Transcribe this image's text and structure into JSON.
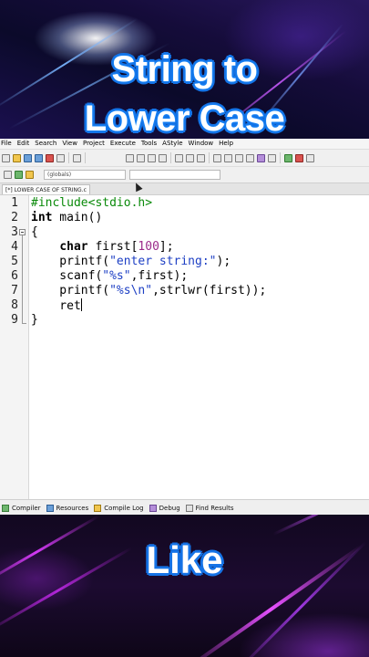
{
  "banner": {
    "title_line1": "String to",
    "title_line2": "Lower Case",
    "footer_text": "Like"
  },
  "menu": [
    "File",
    "Edit",
    "Search",
    "View",
    "Project",
    "Execute",
    "Tools",
    "AStyle",
    "Window",
    "Help"
  ],
  "class_combo": "(globals)",
  "file_tab": "[*] LOWER CASE OF STRING.c",
  "line_numbers": [
    "1",
    "2",
    "3",
    "4",
    "5",
    "6",
    "7",
    "8",
    "9"
  ],
  "code": {
    "l1_directive": "#include<stdio.h>",
    "l2_type": "int",
    "l2_rest": " main()",
    "l3": "{",
    "l4_indent": "    ",
    "l4_type": "char",
    "l4_rest1": " first[",
    "l4_num": "100",
    "l4_rest2": "];",
    "l5_fn": "    printf(",
    "l5_str": "\"enter string:\"",
    "l5_end": ");",
    "l6_fn": "    scanf(",
    "l6_str": "\"%s\"",
    "l6_end": ",first);",
    "l7_fn": "    printf(",
    "l7_str": "\"%s\\n\"",
    "l7_end": ",strlwr(first));",
    "l8_text": "    ret",
    "l9": "}"
  },
  "status_bar": [
    "Compiler",
    "Resources",
    "Compile Log",
    "Debug",
    "Find Results"
  ],
  "colors": {
    "title_outline": "#1573e6",
    "keyword_color": "#000000",
    "preprocessor_color": "#0a8a0a",
    "string_color": "#1d3fc4",
    "number_color": "#9b2a8a"
  }
}
